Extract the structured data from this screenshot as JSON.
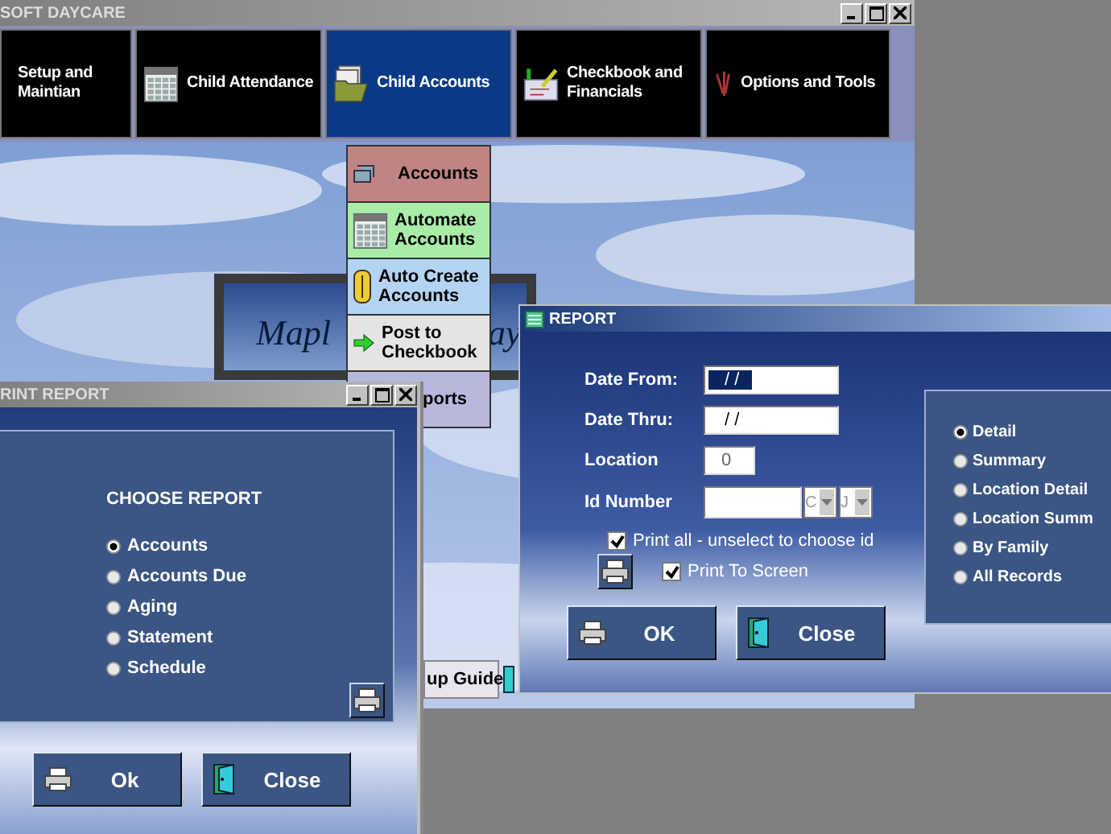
{
  "main_window": {
    "title": "SOFT DAYCARE",
    "toolbar": [
      {
        "label": "Setup and Maintian",
        "selected": false
      },
      {
        "label": "Child Attendance",
        "selected": false
      },
      {
        "label": "Child Accounts",
        "selected": true
      },
      {
        "label": "Checkbook and Financials",
        "selected": false
      },
      {
        "label": "Options and Tools",
        "selected": false
      }
    ],
    "menu": [
      {
        "label": "Accounts",
        "color": "#c08484"
      },
      {
        "label": "Automate Accounts",
        "color": "#a8eca8"
      },
      {
        "label": "Auto Create Accounts",
        "color": "#b4d4f4"
      },
      {
        "label": "Post to Checkbook",
        "color": "#e4e4e4"
      },
      {
        "label": "ports",
        "color": "#b8b8dc"
      }
    ],
    "splash_texts": [
      "Mapl",
      "ay"
    ],
    "guide_button": "up Guide"
  },
  "print_report": {
    "title": "RINT REPORT",
    "heading": "CHOOSE REPORT",
    "options": [
      {
        "label": "Accounts",
        "selected": true
      },
      {
        "label": "Accounts Due",
        "selected": false
      },
      {
        "label": "Aging",
        "selected": false
      },
      {
        "label": "Statement",
        "selected": false
      },
      {
        "label": "Schedule",
        "selected": false
      }
    ],
    "buttons": [
      {
        "label": "Ok",
        "kind": "ok"
      },
      {
        "label": "Close",
        "kind": "close"
      }
    ]
  },
  "report": {
    "title": "REPORT",
    "fields": [
      {
        "label": "Date From:",
        "value": "/  /",
        "kind": "date",
        "text_selected": true
      },
      {
        "label": "Date Thru:",
        "value": "/  /",
        "kind": "date",
        "text_selected": false
      },
      {
        "label": "Location",
        "value": "0",
        "kind": "short",
        "text_selected": false
      },
      {
        "label": "Id Number",
        "kind": "id",
        "combos": [
          "C",
          "J"
        ]
      }
    ],
    "checkboxes": [
      {
        "label": "Print all - unselect to choose id",
        "checked": true
      },
      {
        "label": "Print To Screen",
        "checked": true
      }
    ],
    "options": [
      {
        "label": "Detail",
        "selected": true
      },
      {
        "label": "Summary",
        "selected": false
      },
      {
        "label": "Location Detail",
        "selected": false
      },
      {
        "label": "Location Summ",
        "selected": false
      },
      {
        "label": "By Family",
        "selected": false
      },
      {
        "label": "All Records",
        "selected": false
      }
    ],
    "buttons": [
      {
        "label": "OK",
        "kind": "ok"
      },
      {
        "label": "Close",
        "kind": "close"
      }
    ]
  }
}
